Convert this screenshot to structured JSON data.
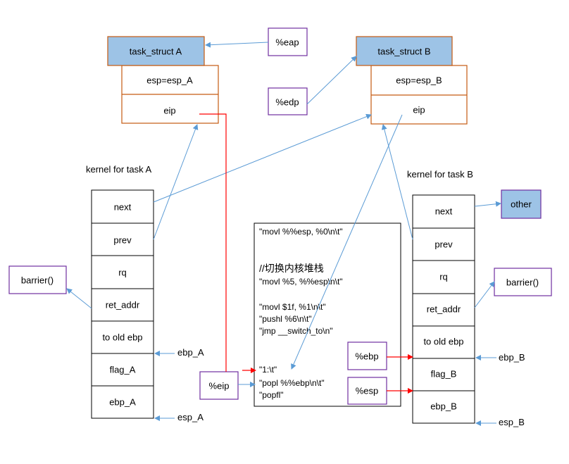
{
  "task_a": {
    "title": "task_struct A",
    "esp": "esp=esp_A",
    "eip": "eip"
  },
  "task_b": {
    "title": "task_struct B",
    "esp": "esp=esp_B",
    "eip": "eip"
  },
  "registers": {
    "eap": "%eap",
    "edp": "%edp",
    "eip": "%eip",
    "ebp": "%ebp",
    "esp": "%esp"
  },
  "other": "other",
  "stack_a": {
    "label": "kernel for task A",
    "cells": [
      "next",
      "prev",
      "rq",
      "ret_addr",
      "to old ebp",
      "flag_A",
      "ebp_A"
    ],
    "barrier": "barrier()",
    "ebp_label": "ebp_A",
    "esp_label": "esp_A"
  },
  "stack_b": {
    "label": "kernel for task B",
    "cells": [
      "next",
      "prev",
      "rq",
      "ret_addr",
      "to old ebp",
      "flag_B",
      "ebp_B"
    ],
    "barrier": "barrier()",
    "ebp_label": "ebp_B",
    "esp_label": "esp_B"
  },
  "code": [
    "\"movl %%esp, %0\\n\\t\"",
    "//切换内核堆栈",
    "\"movl %5, %%esp\\n\\t\"",
    "\"movl $1f, %1\\n\\t\"",
    "\"pushl %6\\n\\t\"",
    "\"jmp __switch_to\\n\"",
    "\"1:\\t\"",
    "\"popl %%ebp\\n\\t\"",
    "\"popfl\""
  ],
  "colors": {
    "struct_fill": "#9DC3E6",
    "struct_border": "#C55A11",
    "register_border": "#7030A0",
    "arrow_blue": "#5B9BD5",
    "arrow_red": "#FF0000"
  }
}
